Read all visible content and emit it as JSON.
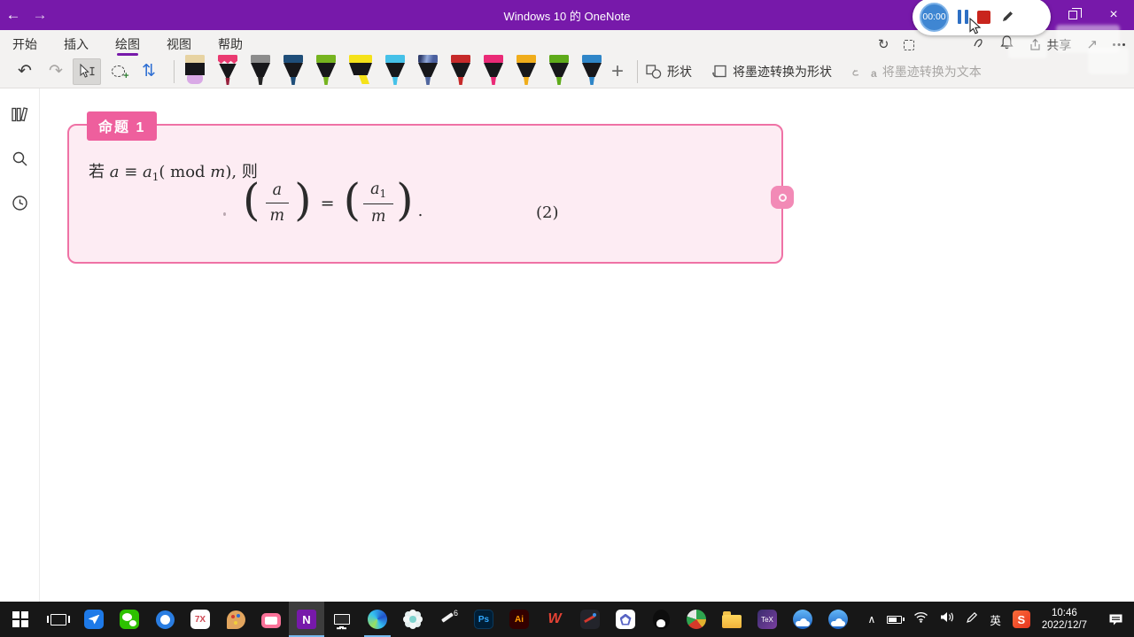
{
  "colors": {
    "accent": "#7719aa",
    "box_border": "#ef72a5",
    "box_bg": "#fdecf3",
    "badge_bg": "#ee5f9d",
    "handle": "#f28ab6",
    "rec_blue": "#3f86d2",
    "rec_red": "#c9251d",
    "taskbar_bg": "#171717",
    "run_indicator": "#76b9ed",
    "ink": "#2b2b2b"
  },
  "icons": {
    "back": "←",
    "forward": "→",
    "close": "×",
    "undo": "↶",
    "redo": "↷",
    "insert_space": "⇅",
    "sync": "↻",
    "share_arrow": "↗",
    "plus": "+",
    "lasso_plus": "+",
    "chevron_up": "∧",
    "ink_to_text_glyph": "a"
  },
  "title_bar": {
    "title": "Windows 10 的 OneNote"
  },
  "recording": {
    "timer": "00:00"
  },
  "ribbon": {
    "tabs": [
      {
        "label": "开始",
        "active": false
      },
      {
        "label": "插入",
        "active": false
      },
      {
        "label": "绘图",
        "active": true
      },
      {
        "label": "视图",
        "active": false
      },
      {
        "label": "帮助",
        "active": false
      }
    ],
    "share_label": "共享",
    "shapes_label": "形状",
    "ink_to_shape_label": "将墨迹转换为形状",
    "ink_to_text_label": "将墨迹转换为文本",
    "pens": [
      {
        "name": "eraser",
        "cap": "#e7d3a2",
        "tip": "#d9a9e6"
      },
      {
        "name": "pencil",
        "cap": "#ea3a70",
        "tip": "#97203c"
      },
      {
        "name": "pen-black",
        "cap": "#8c8c8c",
        "tip": "#262626"
      },
      {
        "name": "pen-navy",
        "cap": "#1f4e79",
        "tip": "#1f4e79"
      },
      {
        "name": "pen-green",
        "cap": "#76b41f",
        "tip": "#76b41f"
      },
      {
        "name": "highlighter-yellow",
        "cap": "#f5e219",
        "tip": "#f5e219"
      },
      {
        "name": "pen-cyan",
        "cap": "#45c1e8",
        "tip": "#45c1e8"
      },
      {
        "name": "pen-galaxy",
        "cap": "#51679f",
        "tip": "#51679f"
      },
      {
        "name": "pen-red",
        "cap": "#c62a2a",
        "tip": "#c62a2a"
      },
      {
        "name": "pen-magenta",
        "cap": "#ea2a77",
        "tip": "#ea2a77"
      },
      {
        "name": "pen-amber",
        "cap": "#f0ad1b",
        "tip": "#f0ad1b"
      },
      {
        "name": "pen-green2",
        "cap": "#5eaa1a",
        "tip": "#5eaa1a"
      },
      {
        "name": "pen-blue",
        "cap": "#2f86c8",
        "tip": "#2f86c8"
      }
    ]
  },
  "canvas": {
    "proposition": {
      "badge": "命题 1",
      "line1": [
        "若 ",
        "a",
        " ≡ ",
        "a",
        "1",
        "( mod ",
        "m",
        "), ",
        "则"
      ],
      "equation": {
        "open": "(",
        "num1": "a",
        "den1": "m",
        "equals": "=",
        "num2": "a",
        "num2_sub": "1",
        "den2": "m",
        "close": ")",
        "period": ".",
        "tag": "(2)"
      }
    }
  },
  "taskbar": {
    "app_labels": {
      "seven_x": "7X",
      "onenote": "N",
      "tablet": "6",
      "photoshop": "Ps",
      "illustrator": "Ai",
      "wps": "W",
      "tex": "TeX"
    },
    "tray": {
      "ime": "英",
      "sogou": "S",
      "time": "10:46",
      "date": "2022/12/7"
    }
  }
}
